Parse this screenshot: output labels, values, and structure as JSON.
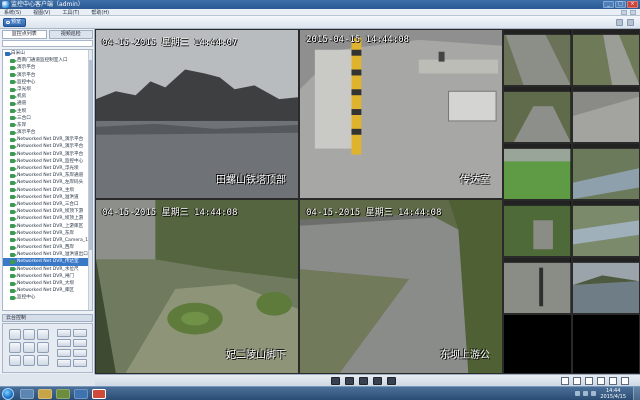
{
  "window": {
    "title": "监控中心客户端（admin）"
  },
  "menu": [
    "系统(S)",
    "视图(V)",
    "工具(T)",
    "帮助(H)"
  ],
  "toolbar": {
    "preview_label": "预览"
  },
  "left_panel": {
    "tabs": [
      "监控点列表",
      "视频巡检"
    ],
    "search_placeholder": "",
    "tree": [
      {
        "label": "白米山",
        "type": "root"
      },
      {
        "label": "西南门通道监控制室入口",
        "type": "cam"
      },
      {
        "label": "演示平台",
        "type": "cam"
      },
      {
        "label": "演示平台",
        "type": "cam"
      },
      {
        "label": "监控中心",
        "type": "cam"
      },
      {
        "label": "浮光坝",
        "type": "cam"
      },
      {
        "label": "机房",
        "type": "cam"
      },
      {
        "label": "通道",
        "type": "cam"
      },
      {
        "label": "主坝",
        "type": "cam"
      },
      {
        "label": "三合口",
        "type": "cam"
      },
      {
        "label": "东岸",
        "type": "cam"
      },
      {
        "label": "演示平台",
        "type": "cam"
      },
      {
        "label": "Networked Net DVR_演示平台",
        "type": "cam"
      },
      {
        "label": "Networked Net DVR_演示平台",
        "type": "cam"
      },
      {
        "label": "Networked Net DVR_演示平台",
        "type": "cam"
      },
      {
        "label": "Networked Net DVR_监控中心",
        "type": "cam"
      },
      {
        "label": "Networked Net DVR_浮光坝",
        "type": "cam"
      },
      {
        "label": "Networked Net DVR_东岸通道",
        "type": "cam"
      },
      {
        "label": "Networked Net DVR_左岸码头",
        "type": "cam"
      },
      {
        "label": "Networked Net DVR_主坝",
        "type": "cam"
      },
      {
        "label": "Networked Net DVR_溢洪道",
        "type": "cam"
      },
      {
        "label": "Networked Net DVR_三合口",
        "type": "cam"
      },
      {
        "label": "Networked Net DVR_坝顶下游",
        "type": "cam"
      },
      {
        "label": "Networked Net DVR_坝顶上游",
        "type": "cam"
      },
      {
        "label": "Networked Net DVR_上游库区",
        "type": "cam"
      },
      {
        "label": "Networked Net DVR_东岸",
        "type": "cam"
      },
      {
        "label": "Networked Net DVR_Camera_14",
        "type": "cam"
      },
      {
        "label": "Networked Net DVR_西岸",
        "type": "cam"
      },
      {
        "label": "Networked Net DVR_溢洪道出口",
        "type": "cam"
      },
      {
        "label": "Networked Net DVR_传达室",
        "type": "cam"
      },
      {
        "label": "Networked Net DVR_水位尺",
        "type": "cam"
      },
      {
        "label": "Networked Net DVR_闸门",
        "type": "cam"
      },
      {
        "label": "Networked Net DVR_大坝",
        "type": "cam"
      },
      {
        "label": "Networked Net DVR_库区",
        "type": "cam"
      },
      {
        "label": "监控中心",
        "type": "cam"
      }
    ],
    "selected_index": 29,
    "ptz_title": "云台控制"
  },
  "cameras": [
    {
      "timestamp": "04-15-2015 星期三 14:44:07",
      "label": "田螺山铁塔顶部"
    },
    {
      "timestamp": "2015-04-15 14:44:08",
      "label": "传达室"
    },
    {
      "timestamp": "04-15-2015 星期三 14:44:08",
      "label": "妃二陵山脚下"
    },
    {
      "timestamp": "04-15-2015 星期三 14:44:08",
      "label": "东坝上游公"
    }
  ],
  "taskbar": {
    "time": "14:44",
    "date": "2015/4/15"
  }
}
